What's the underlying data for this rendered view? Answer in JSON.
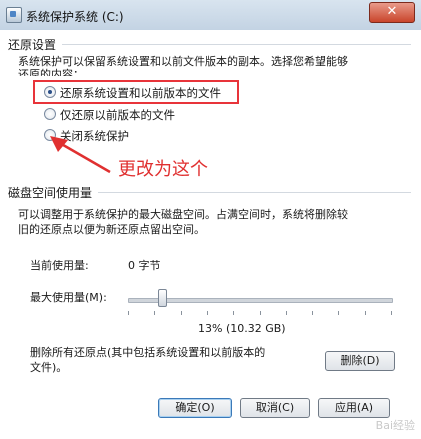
{
  "window": {
    "title": "系统保护系统 (C:)",
    "close_glyph": "✕"
  },
  "restore_settings": {
    "section_title": "还原设置",
    "description_line1": "系统保护可以保留系统设置和以前文件版本的副本。选择您希望能够",
    "description_line2": "还原的内容：",
    "options": [
      {
        "label": "还原系统设置和以前版本的文件",
        "checked": true
      },
      {
        "label": "仅还原以前版本的文件",
        "checked": false
      },
      {
        "label": "关闭系统保护",
        "checked": false
      }
    ]
  },
  "annotation": {
    "text": "更改为这个",
    "color": "#e03030",
    "highlight_color": "#e8343a"
  },
  "disk_space": {
    "section_title": "磁盘空间使用量",
    "description_line1": "可以调整用于系统保护的最大磁盘空间。占满空间时，系统将删除较",
    "description_line2": "旧的还原点以便为新还原点留出空间。",
    "current_usage_label": "当前使用量:",
    "current_usage_value": "0 字节",
    "max_usage_label": "最大使用量(M):",
    "slider_fraction": 0.13,
    "max_usage_readout": "13% (10.32 GB)",
    "delete_description_line1": "删除所有还原点(其中包括系统设置和以前版本的",
    "delete_description_line2": "文件)。",
    "delete_button_label": "删除(D)"
  },
  "footer": {
    "ok_label": "确定(O)",
    "cancel_label": "取消(C)",
    "apply_label": "应用(A)"
  },
  "watermark": "Bai经验"
}
